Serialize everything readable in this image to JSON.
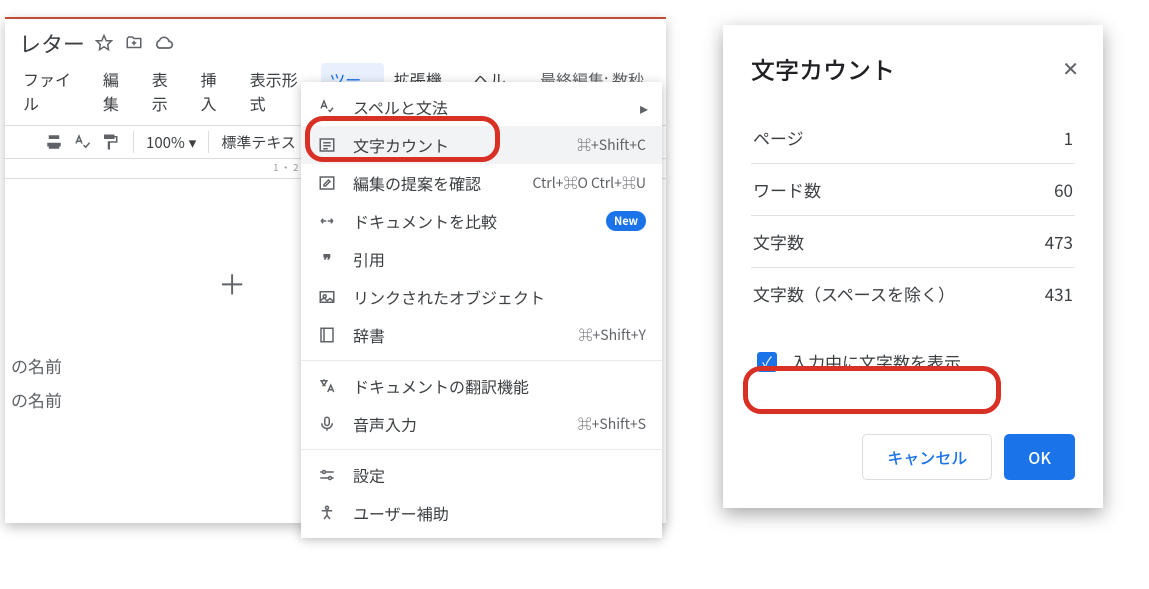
{
  "doc_title": "レター",
  "menus": {
    "file": "ファイル",
    "edit": "編集",
    "view": "表示",
    "insert": "挿入",
    "format": "表示形式",
    "tools": "ツール",
    "ext": "拡張機能",
    "help": "ヘルプ"
  },
  "last_edit": "最終編集: 数秒前",
  "toolbar": {
    "zoom": "100%",
    "style": "標準テキス"
  },
  "ruler": "1 ・ 2",
  "body_line1": "の名前",
  "body_line2": "の名前",
  "dropdown": {
    "spell": "スペルと文法",
    "wordcount": "文字カウント",
    "wordcount_sc": "⌘+Shift+C",
    "suggest": "編集の提案を確認",
    "suggest_sc": "Ctrl+⌘O Ctrl+⌘U",
    "compare": "ドキュメントを比較",
    "new": "New",
    "cite": "引用",
    "linked": "リンクされたオブジェクト",
    "dict": "辞書",
    "dict_sc": "⌘+Shift+Y",
    "translate": "ドキュメントの翻訳機能",
    "voice": "音声入力",
    "voice_sc": "⌘+Shift+S",
    "settings": "設定",
    "a11y": "ユーザー補助"
  },
  "dialog": {
    "title": "文字カウント",
    "page_l": "ページ",
    "page_v": "1",
    "words_l": "ワード数",
    "words_v": "60",
    "chars_l": "文字数",
    "chars_v": "473",
    "charsns_l": "文字数（スペースを除く）",
    "charsns_v": "431",
    "checkbox": "入力中に文字数を表示",
    "cancel": "キャンセル",
    "ok": "OK"
  }
}
